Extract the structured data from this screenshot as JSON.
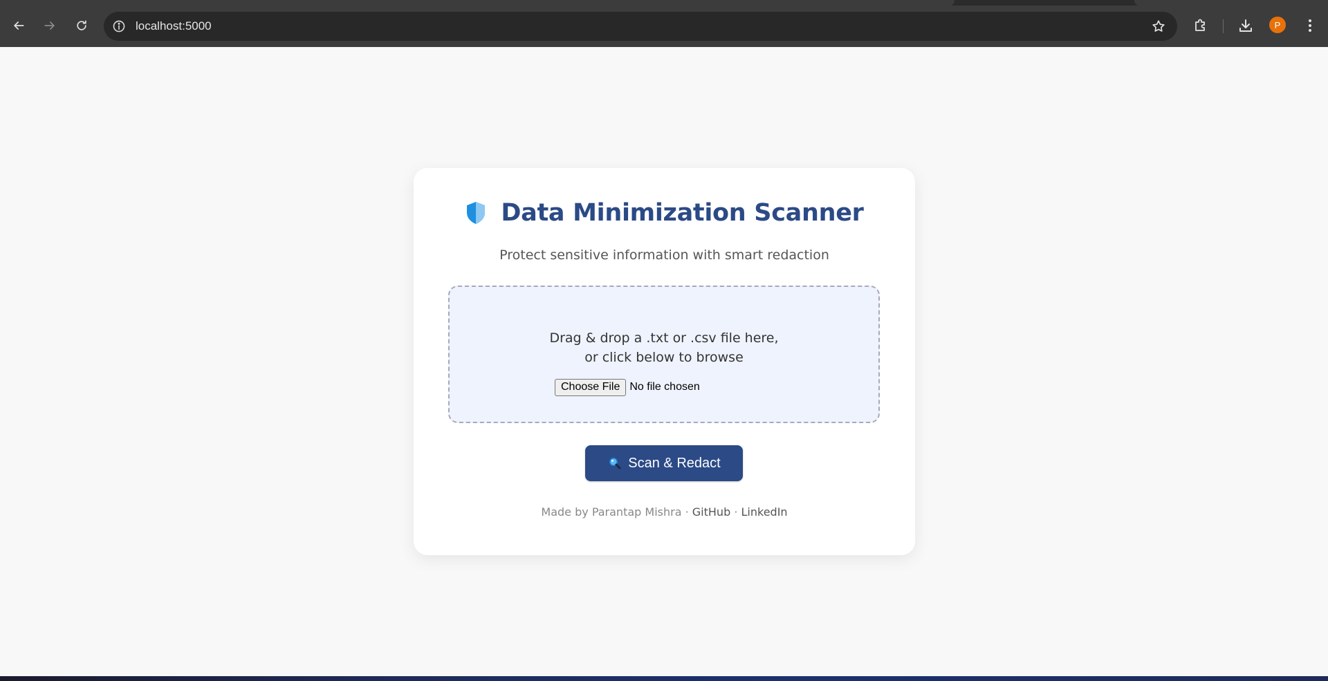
{
  "browser": {
    "url": "localhost:5000",
    "profile_initial": "P"
  },
  "app": {
    "title": "Data Minimization Scanner",
    "subtitle": "Protect sensitive information with smart redaction",
    "dropzone": {
      "line1": "Drag & drop a .txt or .csv file here,",
      "line2": "or click below to browse",
      "choose_label": "Choose File",
      "file_status": "No file chosen"
    },
    "scan_label": "Scan & Redact",
    "footer": {
      "made_by": "Made by Parantap Mishra",
      "sep1": "·",
      "github": "GitHub",
      "sep2": "·",
      "linkedin": "LinkedIn"
    }
  },
  "colors": {
    "brand": "#2b4a86",
    "dropzone_bg": "#eef3fd",
    "profile": "#e8710a"
  },
  "icons": [
    "back-arrow-icon",
    "forward-arrow-icon",
    "reload-icon",
    "site-info-icon",
    "bookmark-star-icon",
    "extensions-icon",
    "download-icon",
    "menu-dots-icon",
    "shield-icon",
    "magnifier-icon"
  ]
}
